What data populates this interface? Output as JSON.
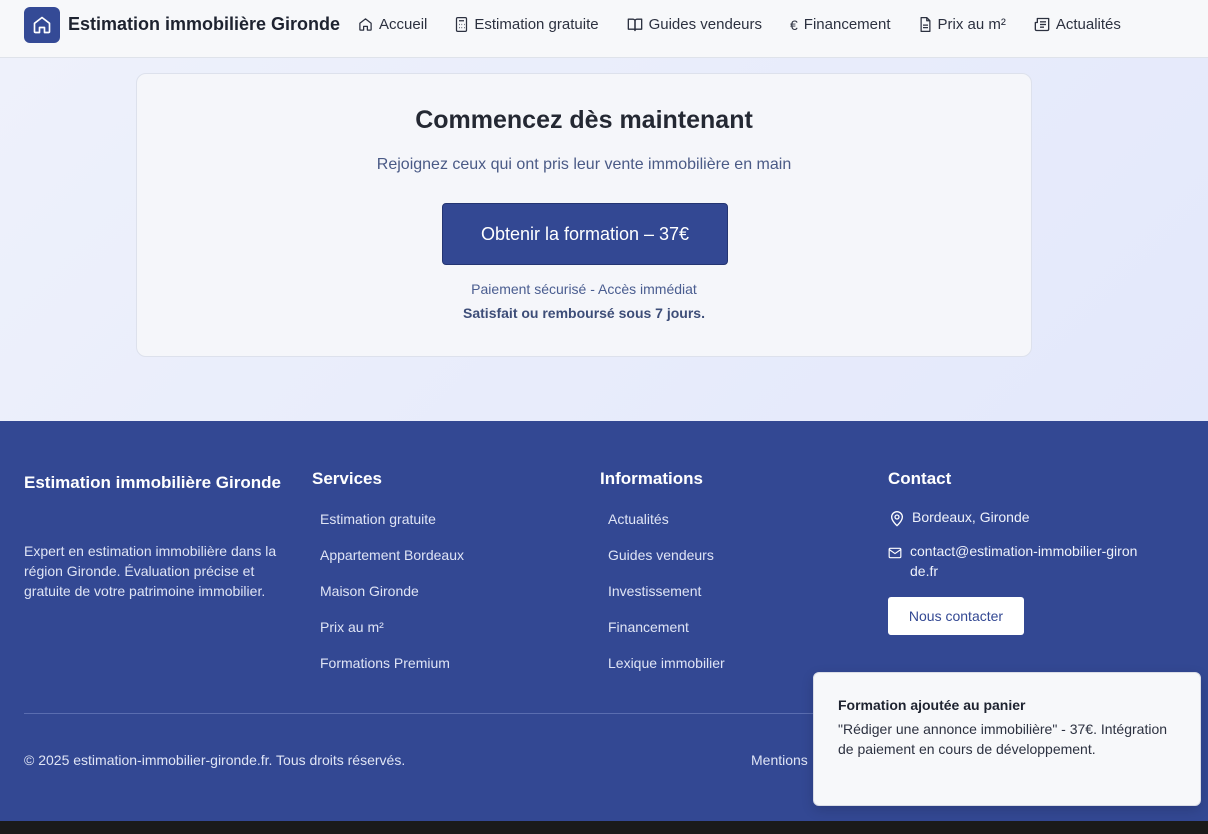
{
  "header": {
    "brand": "Estimation immobilière Gironde",
    "nav": [
      {
        "label": "Accueil",
        "icon": "home-icon"
      },
      {
        "label": "Estimation gratuite",
        "icon": "calculator-icon"
      },
      {
        "label": "Guides vendeurs",
        "icon": "book-icon"
      },
      {
        "label": "Financement",
        "icon": "euro-icon"
      },
      {
        "label": "Prix au m²",
        "icon": "document-icon"
      },
      {
        "label": "Actualités",
        "icon": "newspaper-icon"
      }
    ]
  },
  "card": {
    "title": "Commencez dès maintenant",
    "subtitle": "Rejoignez ceux qui ont pris leur vente immobilière en main",
    "cta_label": "Obtenir la formation – 37€",
    "secure_text": "Paiement sécurisé - Accès immédiat",
    "guarantee_text": "Satisfait ou remboursé sous 7 jours."
  },
  "footer": {
    "brand": "Estimation immobilière Gironde",
    "description": "Expert en estimation immobilière dans la région Gironde. Évaluation précise et gratuite de votre patrimoine immobilier.",
    "services": {
      "title": "Services",
      "links": [
        "Estimation gratuite",
        "Appartement Bordeaux",
        "Maison Gironde",
        "Prix au m²",
        "Formations Premium"
      ]
    },
    "informations": {
      "title": "Informations",
      "links": [
        "Actualités",
        "Guides vendeurs",
        "Investissement",
        "Financement",
        "Lexique immobilier"
      ]
    },
    "contact": {
      "title": "Contact",
      "location": "Bordeaux, Gironde",
      "email": "contact@estimation-immobilier-gironde.fr",
      "button_label": "Nous contacter"
    },
    "copyright": "© 2025 estimation-immobilier-gironde.fr. Tous droits réservés.",
    "mentions": "Mentions"
  },
  "toast": {
    "title": "Formation ajoutée au panier",
    "body": "\"Rédiger une annonce immobilière\" - 37€. Intégration de paiement en cours de développement."
  },
  "colors": {
    "primary": "#334893",
    "background": "#e8ecfb"
  }
}
